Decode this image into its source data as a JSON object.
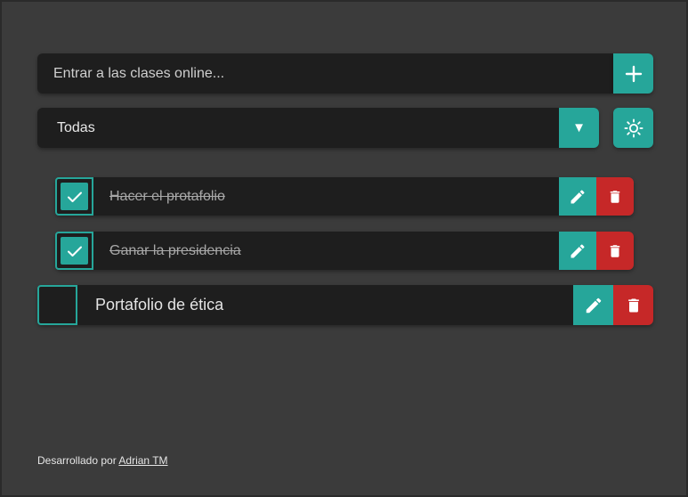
{
  "input": {
    "placeholder": "Entrar a las clases online...",
    "add_icon": "plus-icon"
  },
  "filter": {
    "selected": "Todas",
    "arrow": "▼",
    "theme_icon": "sun-icon"
  },
  "todos": [
    {
      "text": "Hacer el protafolio",
      "completed": true
    },
    {
      "text": "Ganar la presidencia",
      "completed": true
    },
    {
      "text": "Portafolio de ética",
      "completed": false
    }
  ],
  "footer": {
    "prefix": "Desarrollado por",
    "author": "Adrian TM"
  },
  "colors": {
    "background": "#3b3b3b",
    "surface": "#1e1e1e",
    "accent": "#26a69a",
    "danger": "#c62828"
  }
}
